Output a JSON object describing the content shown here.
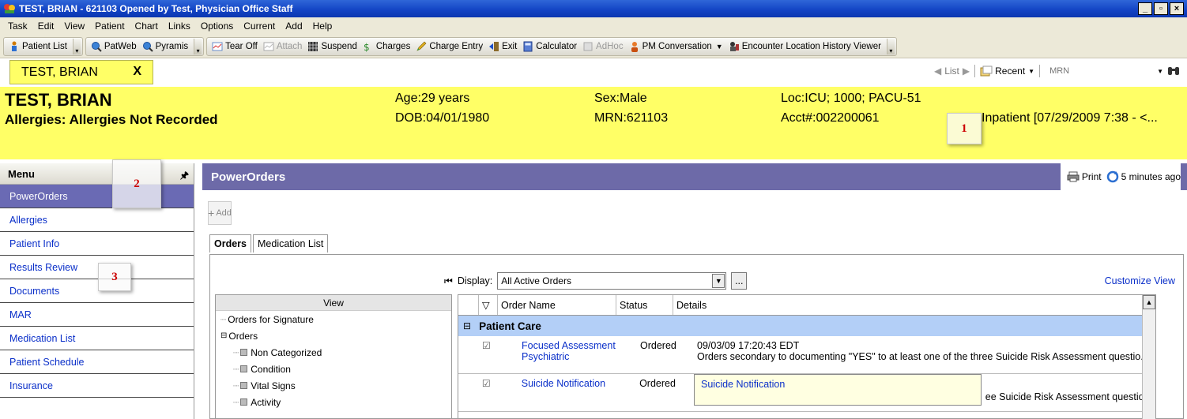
{
  "window": {
    "title": "TEST, BRIAN - 621103 Opened by Test, Physician Office Staff",
    "buttons": [
      "_",
      "▫",
      "×"
    ]
  },
  "menubar": [
    "Task",
    "Edit",
    "View",
    "Patient",
    "Chart",
    "Links",
    "Options",
    "Current",
    "Add",
    "Help"
  ],
  "toolbar": {
    "patient_list": "Patient List",
    "patweb": "PatWeb",
    "pyramis": "Pyramis",
    "tear_off": "Tear Off",
    "attach": "Attach",
    "suspend": "Suspend",
    "charges": "Charges",
    "charge_entry": "Charge Entry",
    "exit": "Exit",
    "calculator": "Calculator",
    "adhoc": "AdHoc",
    "pm_conversation": "PM Conversation",
    "encounter_history": "Encounter Location History Viewer"
  },
  "patient_tab": {
    "label": "TEST, BRIAN",
    "close": "X"
  },
  "nav": {
    "list": "List",
    "recent": "Recent",
    "mrn_placeholder": "MRN"
  },
  "banner": {
    "name": "TEST, BRIAN",
    "allergies": "Allergies: Allergies Not Recorded",
    "age": "Age:29 years",
    "dob": "DOB:04/01/1980",
    "sex": "Sex:Male",
    "mrn": "MRN:621103",
    "loc": "Loc:ICU; 1000; PACU-51",
    "acct": "Acct#:002200061",
    "encounter": "Inpatient [07/29/2009 7:38 - <..."
  },
  "menu": {
    "header": "Menu",
    "items": [
      "PowerOrders",
      "Allergies",
      "Patient Info",
      "Results Review",
      "Documents",
      "MAR",
      "Medication List",
      "Patient Schedule",
      "Insurance"
    ]
  },
  "main": {
    "title": "PowerOrders",
    "print": "Print",
    "updated": "5 minutes ago",
    "add": "Add",
    "tabs": [
      "Orders",
      "Medication List"
    ],
    "display_label": "Display:",
    "display_value": "All Active Orders",
    "ellipsis": "...",
    "customize": "Customize View",
    "view_header": "View",
    "tree": [
      "Orders for Signature",
      "Orders",
      "Non Categorized",
      "Condition",
      "Vital Signs",
      "Activity"
    ],
    "columns": [
      "Order Name",
      "Status",
      "Details"
    ],
    "group": "Patient Care",
    "orders": [
      {
        "name1": "Focused Assessment",
        "name2": "Psychiatric",
        "status": "Ordered",
        "detail1": "09/03/09 17:20:43 EDT",
        "detail2": "Orders secondary to documenting \"YES\" to at least one of the three Suicide Risk Assessment questio..."
      },
      {
        "name1": "Suicide Notification",
        "status": "Ordered",
        "detail_partial": "ee Suicide Risk Assessment questio..."
      }
    ],
    "tooltip": "Suicide Notification"
  },
  "callouts": [
    "1",
    "2",
    "3"
  ]
}
